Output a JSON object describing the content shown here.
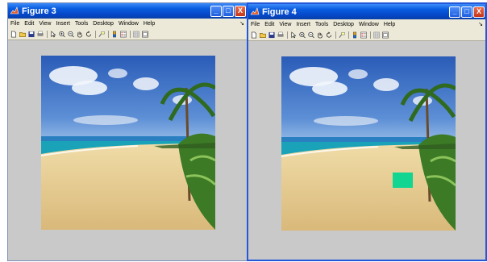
{
  "windows": [
    {
      "id": "left",
      "title": "Figure 3",
      "menu": [
        "File",
        "Edit",
        "View",
        "Insert",
        "Tools",
        "Desktop",
        "Window",
        "Help"
      ],
      "toolbar_icons": [
        "new-file-icon",
        "open-folder-icon",
        "save-icon",
        "print-icon",
        "pointer-icon",
        "zoom-in-icon",
        "zoom-out-icon",
        "pan-hand-icon",
        "rotate-icon",
        "data-cursor-icon",
        "colorbar-icon",
        "legend-icon",
        "grid-icon",
        "plot-tools-icon"
      ],
      "has_marked_region": false
    },
    {
      "id": "right",
      "title": "Figure 4",
      "menu": [
        "File",
        "Edit",
        "View",
        "Insert",
        "Tools",
        "Desktop",
        "Window",
        "Help"
      ],
      "toolbar_icons": [
        "new-file-icon",
        "open-folder-icon",
        "save-icon",
        "print-icon",
        "pointer-icon",
        "zoom-in-icon",
        "zoom-out-icon",
        "pan-hand-icon",
        "rotate-icon",
        "data-cursor-icon",
        "colorbar-icon",
        "legend-icon",
        "grid-icon",
        "plot-tools-icon"
      ],
      "has_marked_region": true
    }
  ],
  "title_buttons": {
    "minimize": "_",
    "maximize": "□",
    "close": "X"
  },
  "menu_overflow": "↘",
  "colors": {
    "titlebar": "#0a5ce0",
    "window_bg": "#c9c9c9",
    "menu_bg": "#ece9d8",
    "active_border": "#2458d8",
    "marked_region": "#13d592",
    "sky": "#3f6ec6",
    "sea": "#1aa3b8",
    "sand": "#e9d49a",
    "palm": "#3c7a25"
  },
  "icons": {
    "window_icon": "matlab-logo-icon"
  }
}
